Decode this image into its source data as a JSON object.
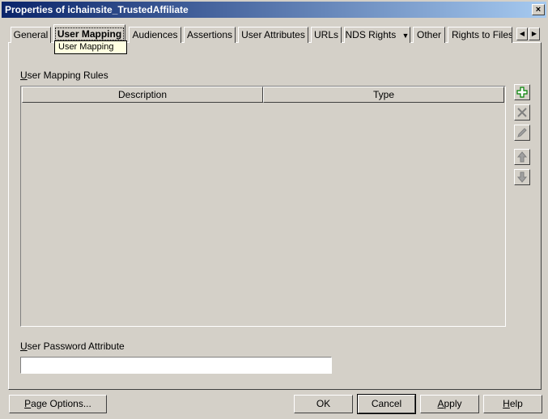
{
  "window": {
    "title": "Properties of ichainsite_TrustedAffiliate",
    "close_glyph": "×"
  },
  "tabs": [
    {
      "label": "General"
    },
    {
      "label": "User Mapping",
      "active": true
    },
    {
      "label": "Audiences"
    },
    {
      "label": "Assertions"
    },
    {
      "label": "User Attributes"
    },
    {
      "label": "URLs"
    },
    {
      "label": "NDS Rights",
      "dropdown": true
    },
    {
      "label": "Other"
    },
    {
      "label": "Rights to Files"
    }
  ],
  "tab_dropdown_glyph": "▼",
  "tab_scroll": {
    "left_icon": "◀",
    "right_icon": "▶"
  },
  "tooltip": "User Mapping",
  "rules_section": {
    "label_first": "U",
    "label_rest": "ser Mapping Rules",
    "columns": [
      "Description",
      "Type"
    ],
    "rows": []
  },
  "side_buttons": [
    {
      "name": "add-icon",
      "color": "#008000"
    },
    {
      "name": "delete-icon",
      "color": "#808080"
    },
    {
      "name": "edit-icon",
      "color": "#808080"
    },
    {
      "name": "move-up-icon",
      "color": "#808080"
    },
    {
      "name": "move-down-icon",
      "color": "#808080"
    }
  ],
  "password_attribute": {
    "label_first": "U",
    "label_rest": "ser Password Attribute",
    "value": ""
  },
  "footer": {
    "page_options_first": "P",
    "page_options_rest": "age Options...",
    "ok": "OK",
    "cancel": "Cancel",
    "apply_first": "A",
    "apply_rest": "pply",
    "help_first": "H",
    "help_rest": "elp"
  },
  "colors": {
    "titlebar_start": "#0a246a",
    "titlebar_end": "#a6caf0",
    "face": "#d4d0c8"
  }
}
